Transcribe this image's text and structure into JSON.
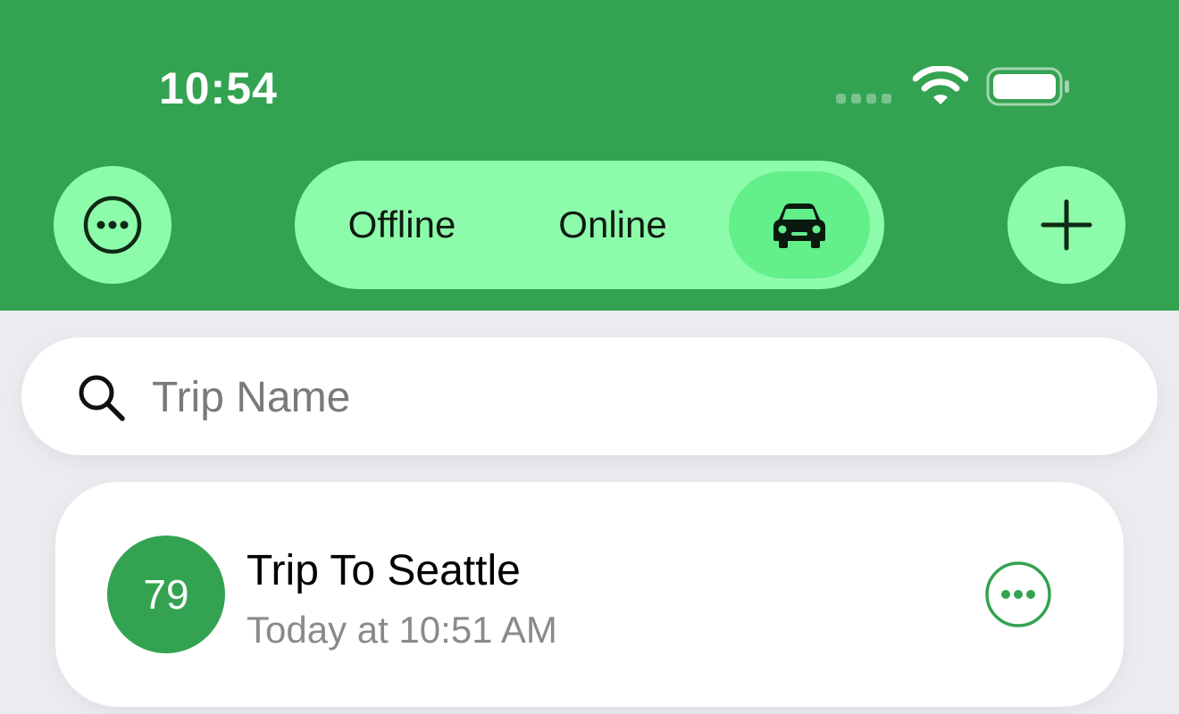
{
  "status_bar": {
    "time": "10:54",
    "icons": [
      "signal-dots-icon",
      "wifi-icon",
      "battery-icon"
    ]
  },
  "toolbar": {
    "menu_icon": "ellipsis-circle-icon",
    "add_icon": "plus-icon",
    "segments": [
      {
        "label": "Offline",
        "selected": false
      },
      {
        "label": "Online",
        "selected": false
      },
      {
        "label": "",
        "icon": "car-icon",
        "selected": true
      }
    ]
  },
  "search": {
    "placeholder": "Trip Name",
    "value": "",
    "icon": "search-icon"
  },
  "trips": [
    {
      "number": "79",
      "title": "Trip To Seattle",
      "date": "Today at 10:51 AM",
      "more_icon": "ellipsis-circle-icon"
    }
  ],
  "colors": {
    "header_green": "#33a351",
    "accent_light": "#8dfcaa",
    "segment_selected": "#63ef8a",
    "background": "#ebebf0"
  }
}
